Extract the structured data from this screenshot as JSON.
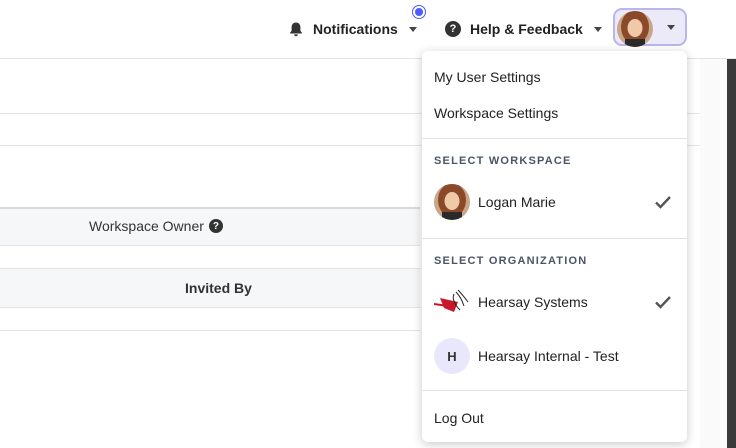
{
  "header": {
    "notifications_label": "Notifications",
    "help_label": "Help & Feedback"
  },
  "table": {
    "workspace_owner_label": "Workspace Owner",
    "invited_by_label": "Invited By"
  },
  "menu": {
    "my_user_settings": "My User Settings",
    "workspace_settings": "Workspace Settings",
    "select_workspace_label": "SELECT WORKSPACE",
    "workspaces": [
      {
        "name": "Logan Marie",
        "selected": true
      }
    ],
    "select_organization_label": "SELECT ORGANIZATION",
    "organizations": [
      {
        "name": "Hearsay Systems",
        "selected": true
      },
      {
        "name": "Hearsay Internal - Test",
        "initial": "H",
        "selected": false
      }
    ],
    "log_out": "Log Out"
  },
  "colors": {
    "accent": "#4c5bff",
    "avatar_button_bg": "#eceaf8",
    "avatar_button_border": "#b9b6ef",
    "section_label": "#4a5566"
  },
  "icons": {
    "notifications": "bell-icon",
    "help": "question-circle-icon",
    "selected": "checkmark-icon"
  }
}
